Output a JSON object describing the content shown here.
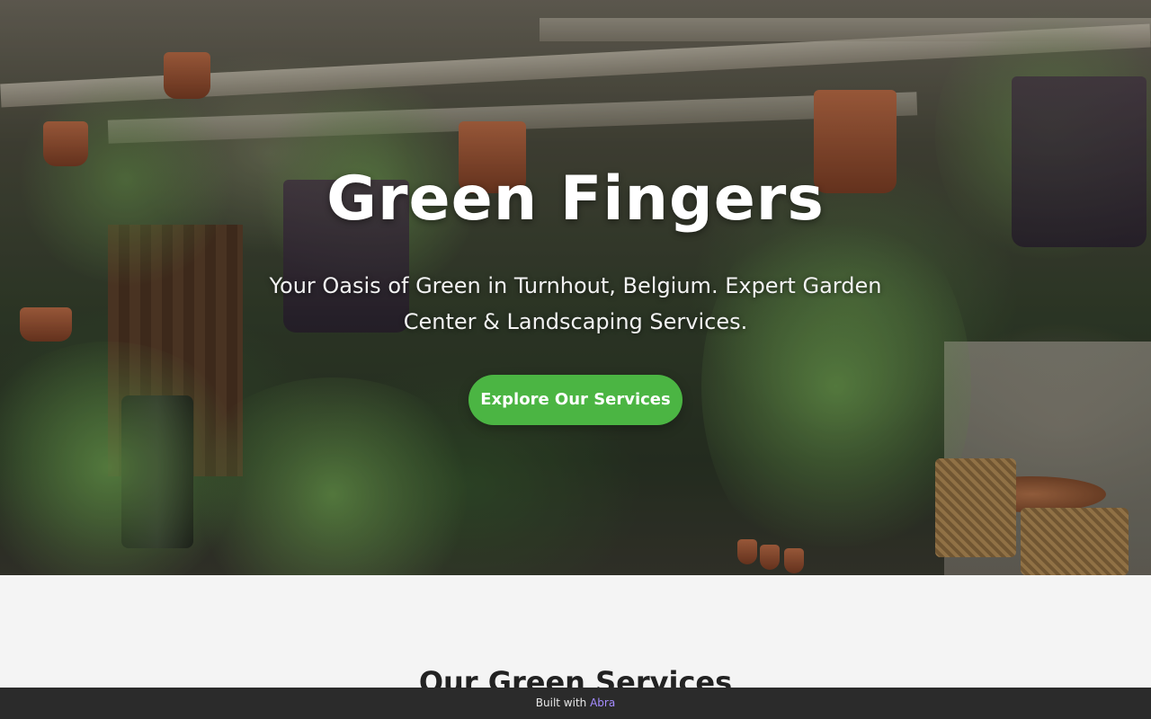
{
  "hero": {
    "title": "Green Fingers",
    "subtitle": "Your Oasis of Green in Turnhout, Belgium. Expert Garden Center & Landscaping Services.",
    "cta_label": "Explore Our Services"
  },
  "services_section": {
    "title": "Our Green Services"
  },
  "built_with": {
    "prefix": "Built with",
    "brand": "Abra"
  },
  "colors": {
    "accent": "#4bb543",
    "brand_link": "#a58cff",
    "footer_bar": "#2b2b2b"
  }
}
